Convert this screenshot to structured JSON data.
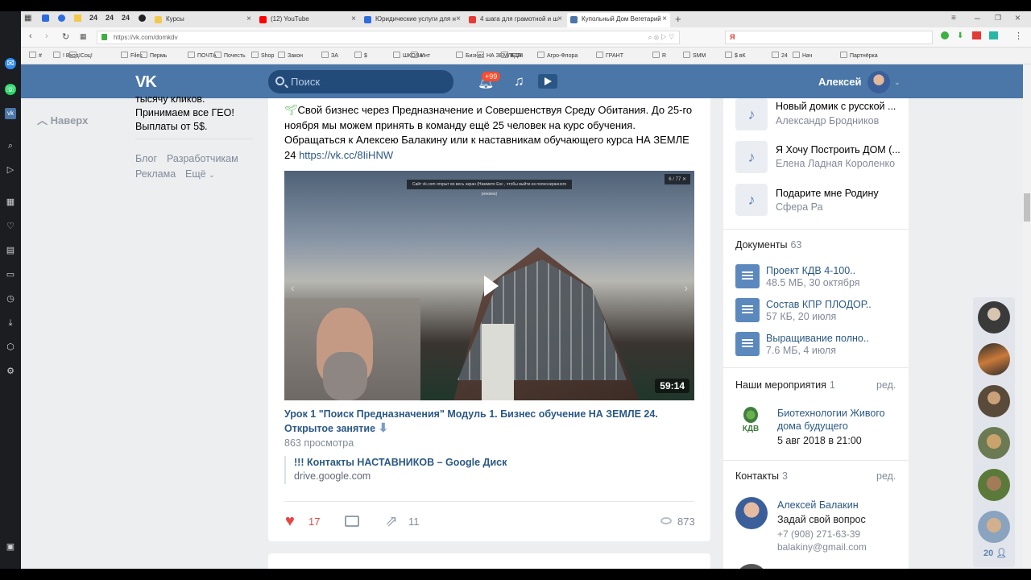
{
  "browser": {
    "pinned": [
      "24",
      "24",
      "24"
    ],
    "tabs": [
      {
        "label": "Курсы",
        "color": "#f2c94c"
      },
      {
        "label": "(12) YouTube",
        "color": "#ff0000"
      },
      {
        "label": "Юридические услуги для н",
        "color": "#2d6cdf"
      },
      {
        "label": "4 шага для грамотной и ш",
        "color": "#e53935"
      },
      {
        "label": "Купольный Дом Вегетарий",
        "color": "#4a76a8"
      }
    ],
    "url": "https://vk.com/domkdv",
    "yandex_search": "Я",
    "bookmarks": [
      "#",
      "! Вход.",
      "!Соц!",
      "Files",
      "Пермь",
      "ПОЧТА",
      "Почесть",
      "Shop",
      "Закон",
      "ЗА",
      "$",
      "ШКОЛА",
      "Инт",
      "Бизнес",
      "НА ЗЕМЛЕ 24",
      "КДВ",
      "Агро-Флора",
      "ГРАНТ",
      "R",
      "SMM",
      "$ вК",
      "24",
      "Нач",
      "Партнёрка"
    ]
  },
  "vk_header": {
    "logo": "VK",
    "search_placeholder": "Поиск",
    "notif_badge": "+99",
    "user_name": "Алексей"
  },
  "left": {
    "back_label": "Наверх",
    "promo": [
      "тысячу кликов.",
      "Принимаем все ГЕО!",
      "Выплаты от 5$."
    ],
    "links": [
      "Блог",
      "Разработчикам",
      "Реклама",
      "Ещё"
    ]
  },
  "post": {
    "text_lines": [
      "Свой бизнес через Предназначение и Совершенствуя Среду Обитания. До 25-го",
      "ноября мы можем принять в команду ещё 25 человек на курс обучения.",
      "Обращаться к Алексею Балакину или к наставникам обучающего курса НА ЗЕМЛЕ",
      "24 "
    ],
    "link": "https://vk.cc/8IiHNW",
    "video": {
      "duration": "59:14",
      "counter": "6 / 77",
      "notice": "Сайт vk.com открыт во весь экран (Нажмите Esc , чтобы выйти из полноэкранного режима)"
    },
    "video_title": "Урок 1 \"Поиск Предназначения\" Модуль 1. Бизнес обучение НА ЗЕМЛЕ 24. Открытое занятие",
    "video_views": "863 просмотра",
    "attached_title": "!!! Контакты НАСТАВНИКОВ – Google Диск",
    "attached_domain": "drive.google.com",
    "likes": "17",
    "shares": "11",
    "views": "873"
  },
  "right": {
    "audio": [
      {
        "title": "Новый домик с русской ...",
        "artist": "Александр Бродников"
      },
      {
        "title": "Я Хочу Построить ДОМ (...",
        "artist": "Елена Ладная Короленко"
      },
      {
        "title": "Подарите мне Родину",
        "artist": "Сфера Ра"
      }
    ],
    "docs_label": "Документы",
    "docs_count": "63",
    "docs": [
      {
        "name": "Проект КДВ 4-100..",
        "meta": "48.5 МБ, 30 октября"
      },
      {
        "name": "Состав КПР ПЛОДОР..",
        "meta": "57 КБ, 20 июля"
      },
      {
        "name": "Выращивание полно..",
        "meta": "7.6 МБ, 4 июля"
      }
    ],
    "events_label": "Наши мероприятия",
    "events_count": "1",
    "edit_label": "ред.",
    "event_logo": "КДВ",
    "event_name": "Биотехнологии Живого дома будущего",
    "event_date": "5 авг 2018 в 21:00",
    "contacts_label": "Контакты",
    "contacts_count": "3",
    "contact_name": "Алексей Балакин",
    "contact_role": "Задай свой вопрос",
    "contact_phone": "+7 (908) 271-63-39",
    "contact_email": "balakiny@gmail.com"
  },
  "friends_count": "20"
}
